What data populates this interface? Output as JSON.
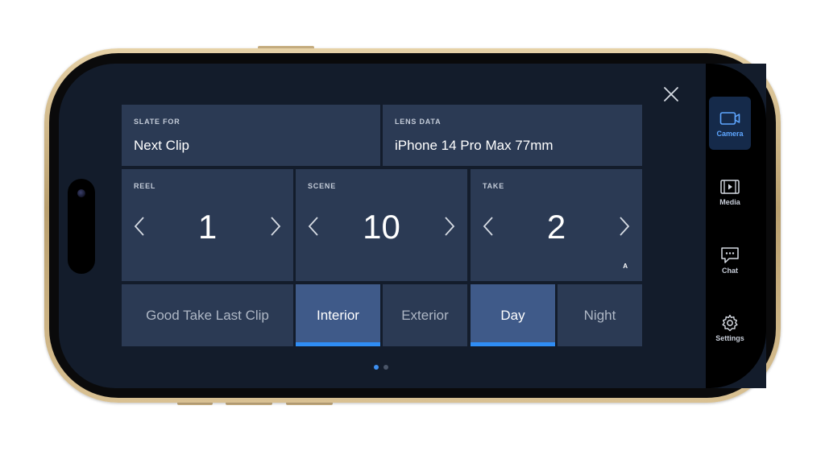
{
  "slate": {
    "slate_for": {
      "label": "SLATE FOR",
      "value": "Next Clip"
    },
    "lens_data": {
      "label": "LENS DATA",
      "value": "iPhone 14 Pro Max 77mm"
    },
    "reel": {
      "label": "REEL",
      "value": "1"
    },
    "scene": {
      "label": "SCENE",
      "value": "10"
    },
    "take": {
      "label": "TAKE",
      "value": "2",
      "badge": "A"
    },
    "good_take": "Good Take Last Clip",
    "interior": "Interior",
    "exterior": "Exterior",
    "day": "Day",
    "night": "Night",
    "selected": [
      "Interior",
      "Day"
    ]
  },
  "sidebar": {
    "items": [
      {
        "label": "Camera",
        "icon": "camera-icon",
        "active": true
      },
      {
        "label": "Media",
        "icon": "film-icon",
        "active": false
      },
      {
        "label": "Chat",
        "icon": "chat-icon",
        "active": false
      },
      {
        "label": "Settings",
        "icon": "gear-icon",
        "active": false
      }
    ]
  },
  "pagination": {
    "pages": 2,
    "current": 1
  },
  "colors": {
    "tile": "#2b3a54",
    "tile_selected": "#3f5a89",
    "accent": "#2f8df5",
    "sidebar_active_text": "#5ea6ff",
    "screen_bg": "#131c2b"
  }
}
